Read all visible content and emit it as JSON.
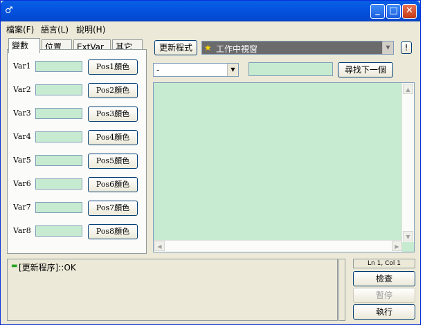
{
  "window": {
    "title": "",
    "icon": "app-icon",
    "controls": [
      "minimize-icon",
      "maximize-icon",
      "close-icon"
    ]
  },
  "menu": [
    "檔案(F)",
    "語言(L)",
    "說明(H)"
  ],
  "tabs": [
    "變數",
    "位置",
    "ExtVar",
    "其它"
  ],
  "vars": [
    {
      "label": "Var1",
      "button": "Pos1顏色"
    },
    {
      "label": "Var2",
      "button": "Pos2顏色"
    },
    {
      "label": "Var3",
      "button": "Pos3顏色"
    },
    {
      "label": "Var4",
      "button": "Pos4顏色"
    },
    {
      "label": "Var5",
      "button": "Pos5顏色"
    },
    {
      "label": "Var6",
      "button": "Pos6顏色"
    },
    {
      "label": "Var7",
      "button": "Pos7顏色"
    },
    {
      "label": "Var8",
      "button": "Pos8顏色"
    }
  ],
  "toolbar": {
    "update_button": "更新程式",
    "window_combo": "工作中視窗",
    "warn_button": "!"
  },
  "search": {
    "dropdown_value": "-",
    "find_next": "尋找下一個"
  },
  "log": {
    "line": "[更新程序]::OK"
  },
  "status": {
    "cursor": "Ln 1, Col 1"
  },
  "side_buttons": {
    "check": "檢查",
    "pause": "暫停",
    "run": "執行"
  },
  "colors": {
    "field_green": "#c6ebd1",
    "title_blue": "#0454e0"
  }
}
